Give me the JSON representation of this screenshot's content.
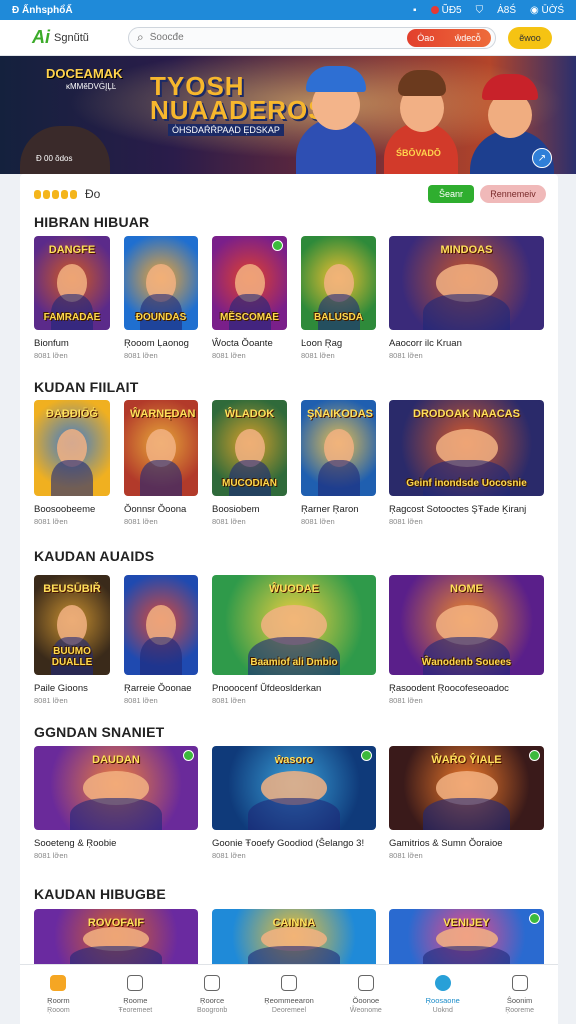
{
  "status": {
    "left": "Đ ẤnhsphổẤ",
    "right": [
      "ŨĐ5",
      "Ȧ8Ś",
      "ŪỜŚ"
    ]
  },
  "header": {
    "logo_mark": "Ai",
    "logo_text": "Sgnũtũ",
    "search_placeholder": "Ŝoocđe",
    "red_button": [
      "Ȯao",
      "ŵdecỗ"
    ],
    "yellow_button": "ẽwoo"
  },
  "hero": {
    "title_line1": "TYOSH",
    "title_line2": "NUAADEROS",
    "subtitle": "ȮHSDAŔŔPAẠD ẸDSKAP",
    "left_title": "DOCEAMAK",
    "left_sub": "ĸMMĕDVĠĮĻĿ",
    "shirt_text": "ŚBŌVADŌ",
    "caption": "Đ 00 ŏdos"
  },
  "toolbar": {
    "coins_label": "Đo",
    "green_button": "Ŝeanr",
    "pink_button": "Ŗennemeiv"
  },
  "sections": [
    {
      "title": "HIBRAN HIBUAR",
      "tiles": [
        {
          "top": "DANGFE",
          "bottom": "FAMRADAE",
          "name": "Bionfum",
          "meta": "8081 lỡen"
        },
        {
          "top": "",
          "bottom": "ĐOUNDAS",
          "name": "Ŗooom Ḷaonog",
          "meta": "8081 lỡen"
        },
        {
          "top": "",
          "bottom": "MĔSCOMAE",
          "name": "Ŵocta Ŏoante",
          "meta": "8081 lỡen"
        },
        {
          "top": "",
          "bottom": "BALUSDA",
          "name": "Ŀoon Ŗag",
          "meta": "8081 lỡen"
        },
        {
          "top": "MINDOAS",
          "bottom": "",
          "name": "Aaocorr ilc Kruan",
          "meta": "8081 lỡen"
        }
      ]
    },
    {
      "title": "KUDAN FIILAIT",
      "tiles": [
        {
          "top": "ĐAĐĐIŌĠ",
          "bottom": "",
          "name": "Boosoobeeme",
          "meta": "8081 lỡen"
        },
        {
          "top": "ŴARNĘDAN",
          "bottom": "",
          "name": "Ŏonnsr Ŏoona",
          "meta": "8081 lỡen"
        },
        {
          "top": "ŴLADOK",
          "bottom": "MUCODIAN",
          "name": "Boosiobem",
          "meta": "8081 lỡen"
        },
        {
          "top": "ŞŃAIKODAS",
          "bottom": "",
          "name": "Ŗarner Ŗaron",
          "meta": "8081 lỡen"
        },
        {
          "top": "DRODOAK   NAACAS",
          "bottom": "Geinf inondsde Uocosnie",
          "name": "Ŗagcost Sotooctes ŞŦade Ḵiranj",
          "meta": "8081 lỡen"
        }
      ]
    },
    {
      "title": "KAUDAN AUAIDS",
      "tiles": [
        {
          "top": "BEUSŪBIŘ",
          "bottom": "BUUMO DUALLE",
          "name": "Paile Gioons",
          "meta": "8081 lỡen"
        },
        {
          "top": "",
          "bottom": "",
          "name": "Ŗarreie Ŏoonae",
          "meta": "8081 lỡen"
        },
        {
          "top": "ŴUODAE",
          "bottom": "Baamiof ali Dmbio",
          "name": "Pnooocenf Ŭfdeoslderkan",
          "meta": "8081 lỡen"
        },
        {
          "top": "NOME",
          "bottom": "Ŵanodenb Souees",
          "name": "Ŗasoodent Ŗoocofeseoadoc",
          "meta": "8081 lỡen"
        }
      ]
    },
    {
      "title": "GGNDAN SNANIET",
      "tiles": [
        {
          "top": "DAUDAN",
          "bottom": "",
          "name": "Sooeteng & Ŗoobie",
          "meta": "8081 lỡen"
        },
        {
          "top": "ŵasoro",
          "bottom": "",
          "name": "Goonie Ŧooefy Goodiod (Ŝelango 3!",
          "meta": "8081 lỡen"
        },
        {
          "top": "ŴAŔO ŶIAĻE",
          "bottom": "",
          "name": "Gamitrios & Sumn Ŏoraioe",
          "meta": "8081 lỡen"
        }
      ]
    },
    {
      "title": "KAUDAN HIBUGBE",
      "tiles": [
        {
          "top": "ROVOFAIF",
          "bottom": "",
          "name": "",
          "meta": ""
        },
        {
          "top": "CAINNA",
          "bottom": "",
          "name": "",
          "meta": ""
        },
        {
          "top": "VENIJEY",
          "bottom": "",
          "name": "",
          "meta": ""
        }
      ]
    }
  ],
  "nav": [
    {
      "l1": "Ŗoorm",
      "l2": "Ŗooom"
    },
    {
      "l1": "Ŗoome",
      "l2": "Ŧeoremeet"
    },
    {
      "l1": "Ŗoorce",
      "l2": "Boogronb"
    },
    {
      "l1": "Ŗeommeearon",
      "l2": "Deoremeel"
    },
    {
      "l1": "Ŏoonoe",
      "l2": "Ŵeonome"
    },
    {
      "l1": "Ŗoosaone",
      "l2": "Uoknd"
    },
    {
      "l1": "Ŝoonim",
      "l2": "Ŗooreme"
    }
  ]
}
